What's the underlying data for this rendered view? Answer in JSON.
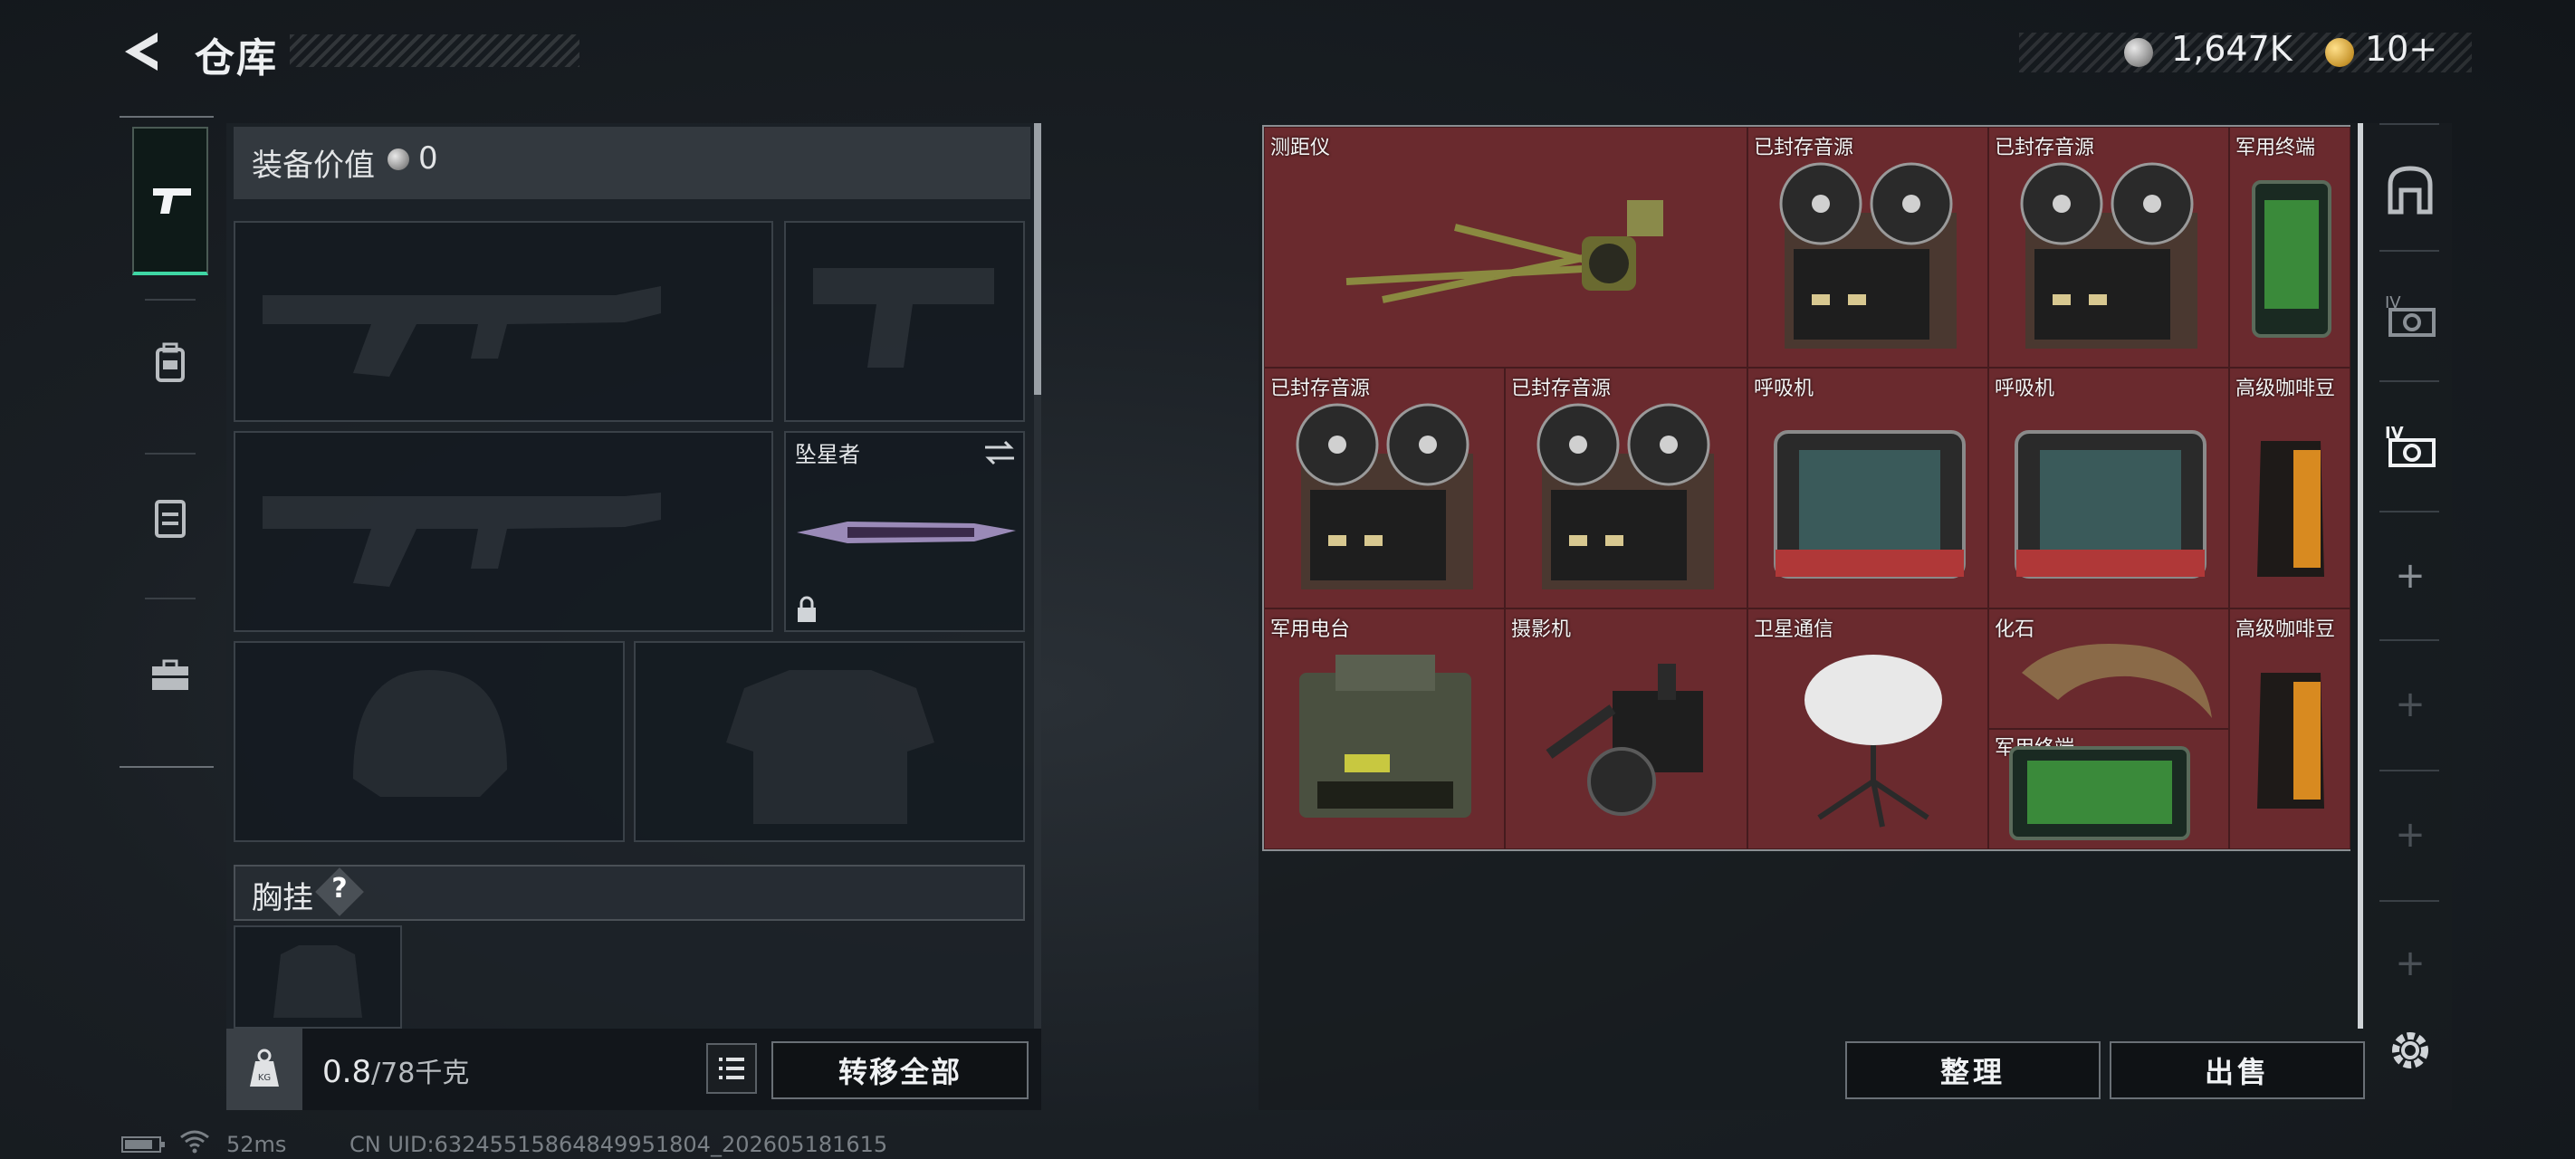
{
  "header": {
    "title": "仓库",
    "currency_silver": "1,647K",
    "currency_gold": "10+"
  },
  "sidebar": {
    "tabs": [
      {
        "icon": "pistol-icon",
        "active": true
      },
      {
        "icon": "backpack-icon"
      },
      {
        "icon": "vest-icon"
      },
      {
        "icon": "toolbox-icon"
      }
    ]
  },
  "equipment": {
    "value_label": "装备价值",
    "value": "0",
    "melee_label": "坠星者",
    "chest_label": "胸挂",
    "help_label": "?",
    "weight_value": "0.8",
    "weight_max": "/78千克",
    "transfer_all_label": "转移全部"
  },
  "container": {
    "items": [
      {
        "label": "测距仪",
        "icon": "rangefinder-icon"
      },
      {
        "label": "已封存音源",
        "icon": "tape-recorder-icon"
      },
      {
        "label": "已封存音源",
        "icon": "tape-recorder-icon"
      },
      {
        "label": "军用终端",
        "icon": "military-terminal-icon"
      },
      {
        "label": "已封存音源",
        "icon": "tape-recorder-icon"
      },
      {
        "label": "已封存音源",
        "icon": "tape-recorder-icon"
      },
      {
        "label": "呼吸机",
        "icon": "ventilator-icon"
      },
      {
        "label": "呼吸机",
        "icon": "ventilator-icon"
      },
      {
        "label": "高级咖啡豆",
        "icon": "coffee-bag-icon"
      },
      {
        "label": "军用电台",
        "icon": "military-radio-icon"
      },
      {
        "label": "摄影机",
        "icon": "video-camera-icon"
      },
      {
        "label": "卫星通信",
        "icon": "satellite-dish-icon"
      },
      {
        "label": "化石",
        "icon": "fossil-claw-icon"
      },
      {
        "label": "军用终端",
        "icon": "military-terminal-icon"
      },
      {
        "label": "高级咖啡豆",
        "icon": "coffee-bag-icon"
      }
    ],
    "sort_label": "整理",
    "sell_label": "出售"
  },
  "status_bar": {
    "ping": "52ms",
    "uid": "CN UID:63245515864849951804_202605181615"
  },
  "colors": {
    "accent": "#3fd7a5",
    "grid_bg": "#6a2a2e"
  }
}
